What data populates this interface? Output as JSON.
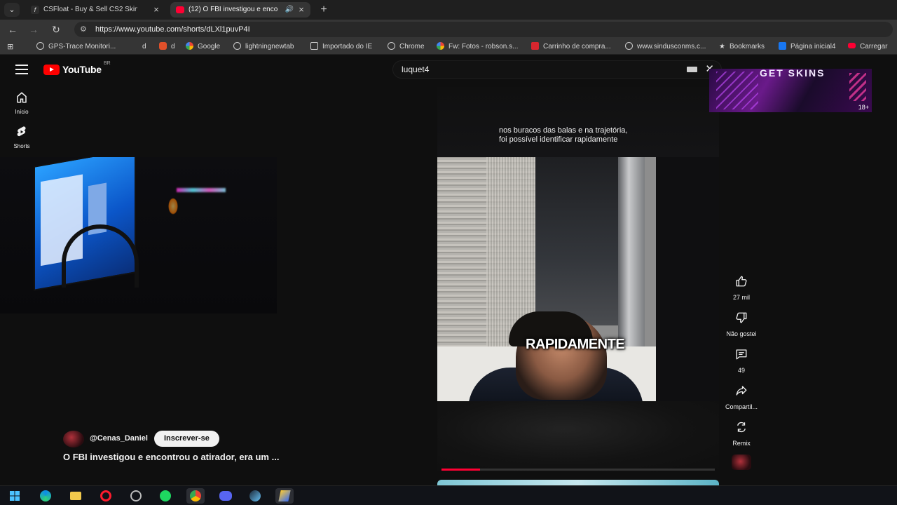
{
  "browser": {
    "tabs": [
      {
        "title": "CSFloat - Buy & Sell CS2 Skins a",
        "favicon": "csfloat-icon",
        "active": false
      },
      {
        "title": "(12) O FBI investigou e enco",
        "favicon": "youtube-icon",
        "active": true
      }
    ],
    "address": {
      "url": "https://www.youtube.com/shorts/dLXl1puvP4I"
    },
    "bookmarks": [
      {
        "label": "GPS-Trace Monitori...",
        "icon": "globe-icon"
      },
      {
        "label": "d",
        "icon": "none"
      },
      {
        "label": "d",
        "icon": "app-icon"
      },
      {
        "label": "Google",
        "icon": "google-icon"
      },
      {
        "label": "lightningnewtab",
        "icon": "globe-icon"
      },
      {
        "label": "Importado do IE",
        "icon": "folder-icon"
      },
      {
        "label": "Chrome",
        "icon": "globe-icon"
      },
      {
        "label": "Fw: Fotos - robson.s...",
        "icon": "google-icon"
      },
      {
        "label": "Carrinho de compra...",
        "icon": "cart-icon"
      },
      {
        "label": "www.sindusconms.c...",
        "icon": "globe-icon"
      },
      {
        "label": "Bookmarks",
        "icon": "star-icon"
      },
      {
        "label": "Página inicial4",
        "icon": "facebook-icon"
      },
      {
        "label": "Carregar",
        "icon": "youtube-icon"
      }
    ]
  },
  "youtube": {
    "logo_text": "YouTube",
    "country_code": "BR",
    "search_query": "luquet4",
    "sidebar": [
      {
        "label": "Início",
        "icon": "home-icon"
      },
      {
        "label": "Shorts",
        "icon": "shorts-icon"
      }
    ],
    "short": {
      "top_caption_line1": "nos buracos das balas e na trajetória,",
      "top_caption_line2": "foi possível identificar rapidamente",
      "video_caption": "RAPIDAMENTE",
      "progress": 0.14,
      "channel_handle": "@Cenas_Daniel",
      "subscribe_label": "Inscrever-se",
      "title": "O FBI investigou e encontrou o atirador, era um ..."
    },
    "actions": [
      {
        "label": "27 mil",
        "icon": "like-icon"
      },
      {
        "label": "Não gostei",
        "icon": "dislike-icon"
      },
      {
        "label": "49",
        "icon": "comment-icon"
      },
      {
        "label": "Compartil...",
        "icon": "share-icon"
      },
      {
        "label": "Remix",
        "icon": "remix-icon"
      }
    ],
    "ad": {
      "title": "GET SKINS",
      "badge": "18+"
    }
  },
  "taskbar": {
    "apps": [
      "windows-start-icon",
      "edge-icon",
      "file-explorer-icon",
      "opera-icon",
      "app-icon",
      "spotify-icon",
      "chrome-icon",
      "discord-icon",
      "steam-icon",
      "app-icon"
    ]
  },
  "colors": {
    "youtube_red": "#ff0000",
    "progress_red": "#ff0033",
    "background": "#0f0f0f"
  }
}
